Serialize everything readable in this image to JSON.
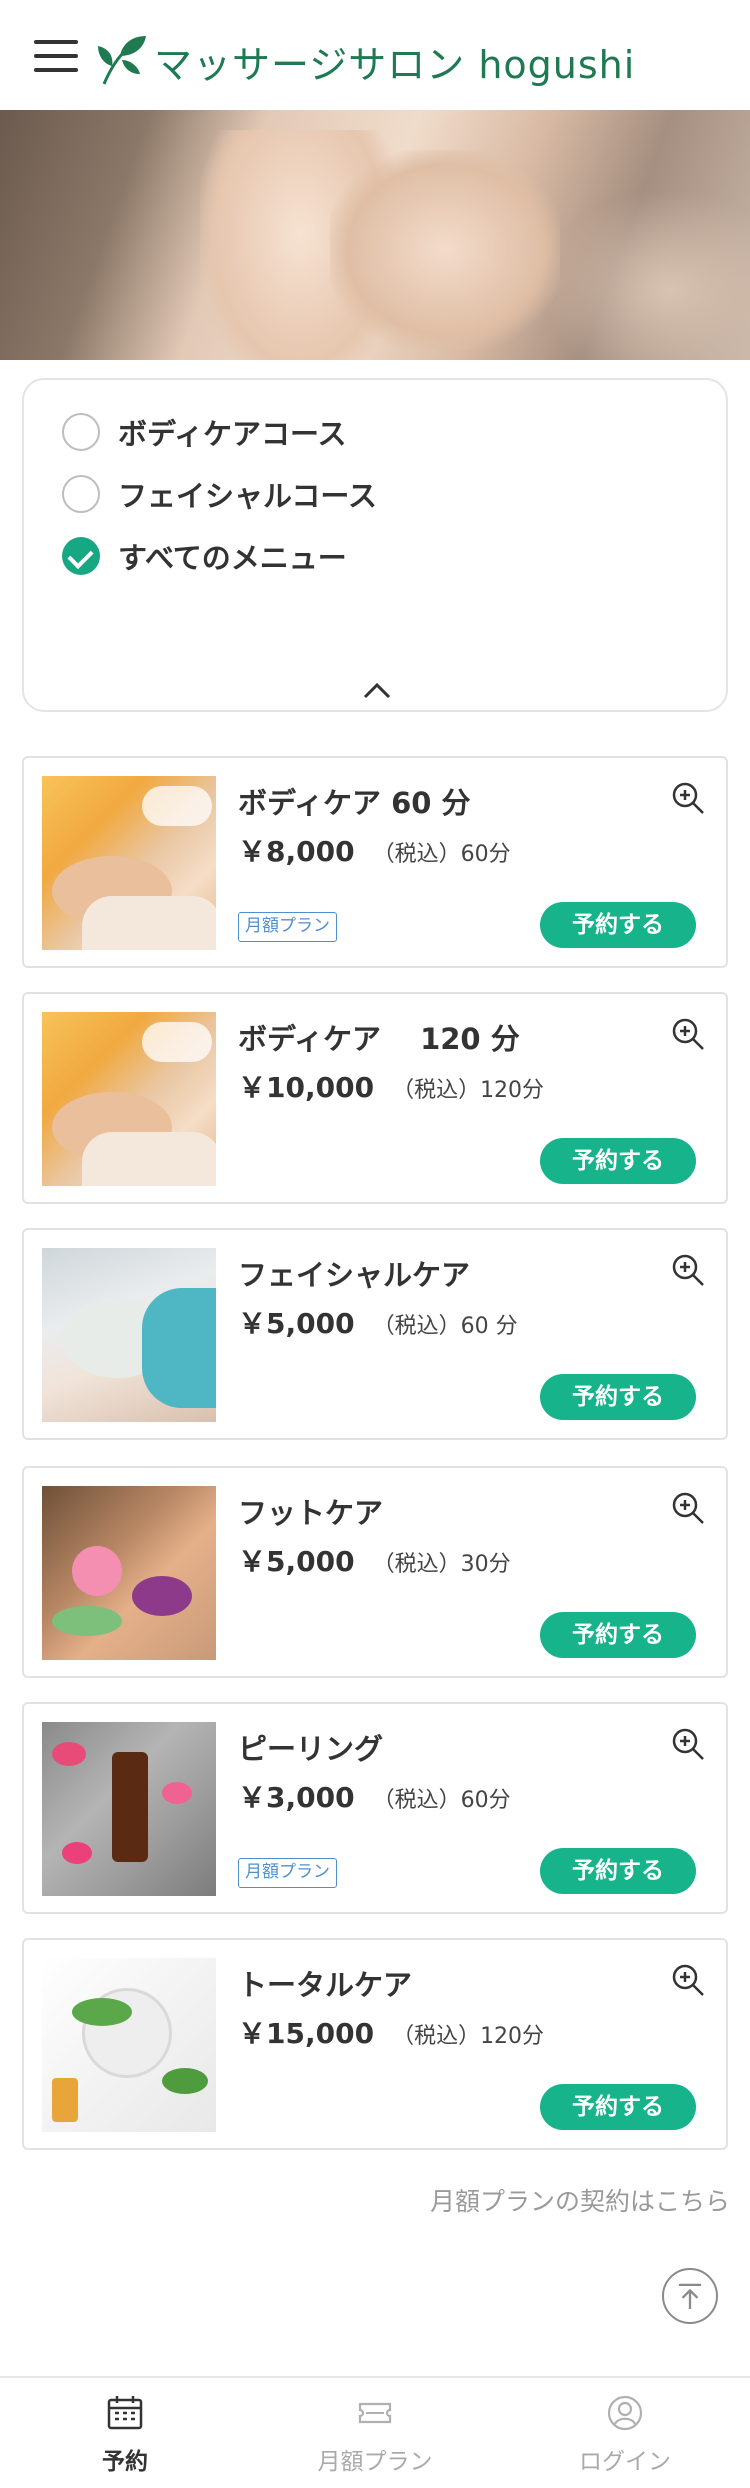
{
  "header": {
    "brand": "マッサージサロン hogushi"
  },
  "filter": {
    "options": [
      {
        "label": "ボディケアコース",
        "checked": false
      },
      {
        "label": "フェイシャルコース",
        "checked": false
      },
      {
        "label": "すべてのメニュー",
        "checked": true
      }
    ]
  },
  "menu": [
    {
      "title": "ボディケア 60 分",
      "price": "￥8,000",
      "tax": "（税込）60分",
      "badge": "月額プラン",
      "button": "予約する"
    },
    {
      "title": "ボディケア　 120 分",
      "price": "￥10,000",
      "tax": "（税込）120分",
      "badge": "",
      "button": "予約する"
    },
    {
      "title": "フェイシャルケア",
      "price": "￥5,000",
      "tax": "（税込）60 分",
      "badge": "",
      "button": "予約する"
    },
    {
      "title": "フットケア",
      "price": "￥5,000",
      "tax": "（税込）30分",
      "badge": "",
      "button": "予約する"
    },
    {
      "title": "ピーリング",
      "price": "￥3,000",
      "tax": "（税込）60分",
      "badge": "月額プラン",
      "button": "予約する"
    },
    {
      "title": "トータルケア",
      "price": "￥15,000",
      "tax": "（税込）120分",
      "badge": "",
      "button": "予約する"
    }
  ],
  "monthly_link": "月額プランの契約はこちら",
  "bottom_nav": [
    {
      "label": "予約",
      "icon": "calendar-icon",
      "active": true
    },
    {
      "label": "月額プラン",
      "icon": "ticket-icon",
      "active": false
    },
    {
      "label": "ログイン",
      "icon": "user-icon",
      "active": false
    }
  ],
  "colors": {
    "accent": "#17b48c",
    "brand": "#1f7a52",
    "badge": "#4e8fd0"
  }
}
